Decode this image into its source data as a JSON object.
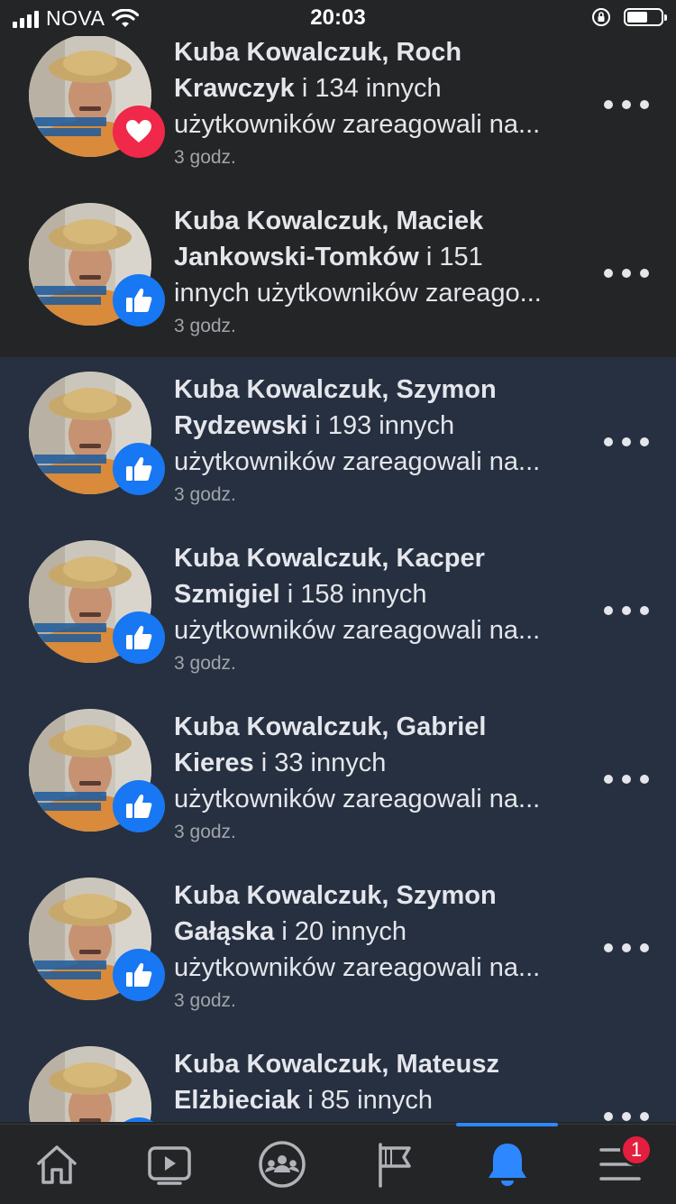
{
  "status_bar": {
    "carrier": "NOVA",
    "time": "20:03",
    "battery_level": 0.6
  },
  "notifications": [
    {
      "line1_bold": "Kuba Kowalczuk, Roch",
      "line2_bold": "Krawczyk",
      "line2_rest": " i 134 innych",
      "line3": "użytkowników zareagowali na...",
      "time": "3 godz.",
      "reaction": "love",
      "reaction_icon": "heart-icon",
      "unread": false
    },
    {
      "line1_bold": "Kuba Kowalczuk, Maciek",
      "line2_bold": "Jankowski-Tomków",
      "line2_rest": " i 151",
      "line3": "innych użytkowników zareago...",
      "time": "3 godz.",
      "reaction": "like",
      "reaction_icon": "thumbs-up-icon",
      "unread": false
    },
    {
      "line1_bold": "Kuba Kowalczuk, Szymon",
      "line2_bold": "Rydzewski",
      "line2_rest": " i 193 innych",
      "line3": "użytkowników zareagowali na...",
      "time": "3 godz.",
      "reaction": "like",
      "reaction_icon": "thumbs-up-icon",
      "unread": true
    },
    {
      "line1_bold": "Kuba Kowalczuk, Kacper",
      "line2_bold": "Szmigiel",
      "line2_rest": " i 158 innych",
      "line3": "użytkowników zareagowali na...",
      "time": "3 godz.",
      "reaction": "like",
      "reaction_icon": "thumbs-up-icon",
      "unread": true
    },
    {
      "line1_bold": "Kuba Kowalczuk, Gabriel",
      "line2_bold": "Kieres",
      "line2_rest": " i 33 innych",
      "line3": "użytkowników zareagowali na...",
      "time": "3 godz.",
      "reaction": "like",
      "reaction_icon": "thumbs-up-icon",
      "unread": true
    },
    {
      "line1_bold": "Kuba Kowalczuk, Szymon",
      "line2_bold": "Gałąska",
      "line2_rest": " i 20 innych",
      "line3": "użytkowników zareagowali na...",
      "time": "3 godz.",
      "reaction": "like",
      "reaction_icon": "thumbs-up-icon",
      "unread": true
    },
    {
      "line1_bold": "Kuba Kowalczuk, Mateusz",
      "line2_bold": "Elżbieciak",
      "line2_rest": " i 85 innych",
      "line3": "",
      "time": "",
      "reaction": "like",
      "reaction_icon": "thumbs-up-icon",
      "unread": true
    }
  ],
  "tab_bar": {
    "tabs": [
      {
        "icon": "home-icon",
        "active": false
      },
      {
        "icon": "watch-video-icon",
        "active": false
      },
      {
        "icon": "groups-icon",
        "active": false
      },
      {
        "icon": "pages-flag-icon",
        "active": false
      },
      {
        "icon": "notifications-bell-icon",
        "active": true
      },
      {
        "icon": "menu-icon",
        "active": false
      }
    ],
    "menu_badge": "1"
  },
  "colors": {
    "background": "#242526",
    "unread_background": "#263040",
    "accent": "#2d88ff",
    "love": "#f02849",
    "like": "#1877f2",
    "badge": "#e41e3f"
  }
}
